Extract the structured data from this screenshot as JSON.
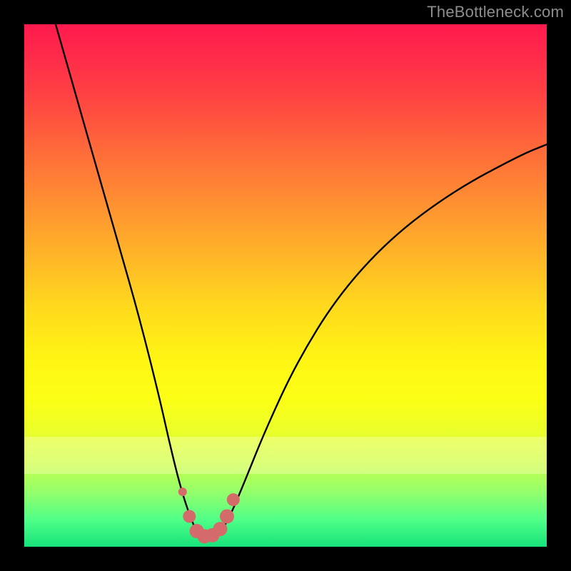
{
  "watermark": "TheBottleneck.com",
  "colors": {
    "frame": "#000000",
    "curve": "#000000",
    "marker": "#d46a6a",
    "marker_stroke": "#c85c5c"
  },
  "chart_data": {
    "type": "line",
    "title": "",
    "xlabel": "",
    "ylabel": "",
    "xlim": [
      0,
      100
    ],
    "ylim": [
      0,
      100
    ],
    "grid": false,
    "legend": false,
    "note": "Bottleneck-style V curve. x is normalized hardware balance; y is mismatch percentage. Values are read approximately from the plotted curve (no axis ticks are shown).",
    "series": [
      {
        "name": "bottleneck-curve",
        "x": [
          6,
          10,
          14,
          18,
          22,
          26,
          28,
          30,
          32,
          33.5,
          35,
          37,
          39,
          42,
          46,
          52,
          60,
          70,
          82,
          95,
          100
        ],
        "y": [
          100,
          86,
          72,
          58,
          44,
          28,
          19,
          11,
          5,
          2,
          1.5,
          2,
          5,
          12,
          22,
          35,
          48,
          59,
          68,
          75,
          77
        ]
      }
    ],
    "markers": {
      "name": "highlight-band",
      "note": "Pink rounded segment near the curve minimum plus one dot on the left arm.",
      "points": [
        {
          "x": 30.3,
          "y": 10.5,
          "r": 6
        },
        {
          "x": 31.6,
          "y": 5.8,
          "r": 9
        },
        {
          "x": 33.0,
          "y": 3.0,
          "r": 10
        },
        {
          "x": 34.5,
          "y": 2.0,
          "r": 10
        },
        {
          "x": 36.0,
          "y": 2.2,
          "r": 10
        },
        {
          "x": 37.5,
          "y": 3.4,
          "r": 10
        },
        {
          "x": 38.8,
          "y": 5.8,
          "r": 10
        },
        {
          "x": 40.0,
          "y": 9.0,
          "r": 9
        }
      ]
    }
  }
}
